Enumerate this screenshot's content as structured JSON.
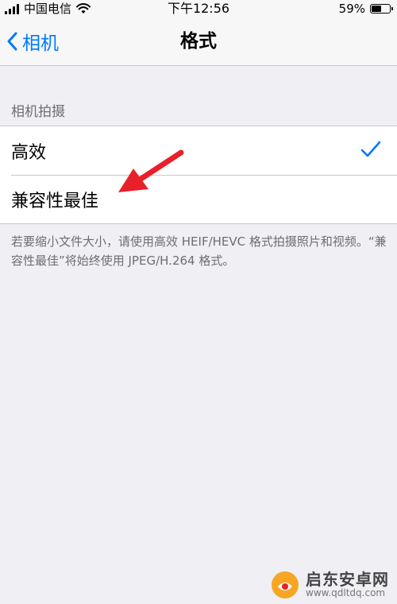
{
  "status_bar": {
    "carrier": "中国电信",
    "time": "下午12:56",
    "battery_percent": "59%",
    "battery_level": 0.59
  },
  "nav": {
    "back_label": "相机",
    "title": "格式"
  },
  "section": {
    "header": "相机拍摄",
    "options": [
      {
        "label": "高效",
        "selected": true
      },
      {
        "label": "兼容性最佳",
        "selected": false
      }
    ],
    "footer": "若要缩小文件大小，请使用高效 HEIF/HEVC 格式拍摄照片和视频。“兼容性最佳”将始终使用 JPEG/H.264 格式。"
  },
  "colors": {
    "accent": "#007aff",
    "annotation_arrow": "#e8202a",
    "background": "#efeff4"
  },
  "watermark": {
    "title": "启东安卓网",
    "url": "www.qdltdq.com"
  }
}
